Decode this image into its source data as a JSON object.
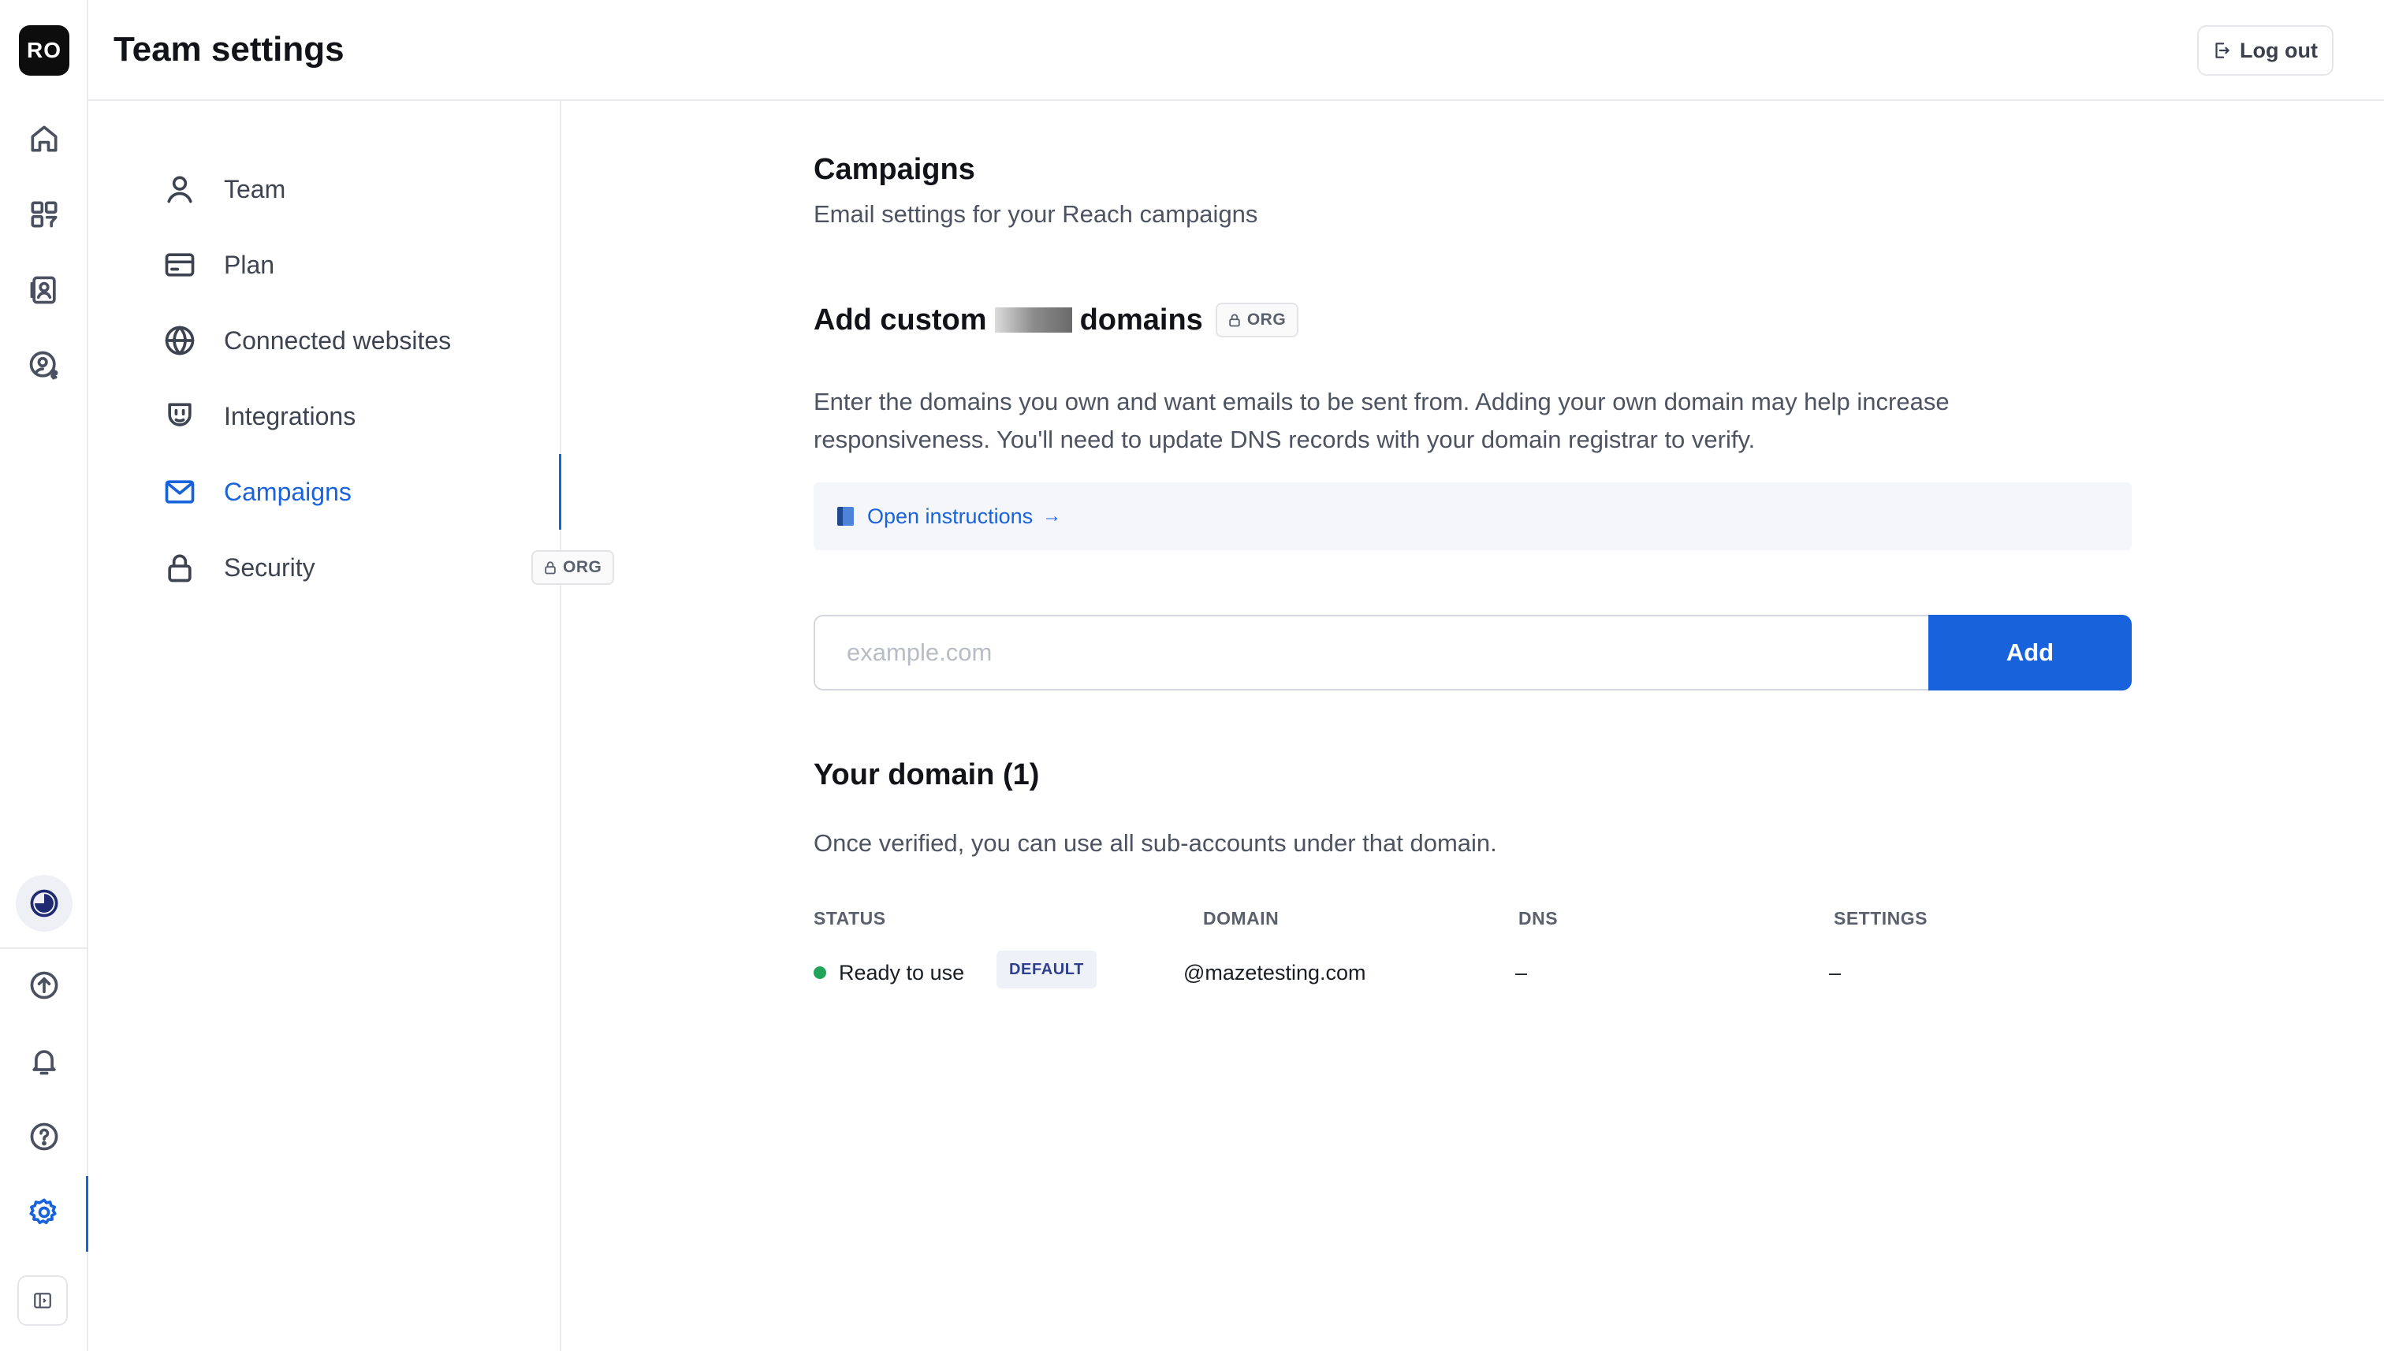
{
  "rail": {
    "avatar": "RO",
    "items": [
      {
        "icon": "home-icon"
      },
      {
        "icon": "apps-icon"
      },
      {
        "icon": "contacts-icon"
      },
      {
        "icon": "user-money-icon"
      },
      {
        "icon": "timer-icon"
      },
      {
        "icon": "upgrade-icon"
      },
      {
        "icon": "bell-icon"
      },
      {
        "icon": "help-icon"
      },
      {
        "icon": "gear-icon"
      }
    ]
  },
  "header": {
    "title": "Team settings",
    "logout_label": "Log out"
  },
  "subnav": {
    "items": [
      {
        "label": "Team",
        "icon": "user-icon"
      },
      {
        "label": "Plan",
        "icon": "credit-card-icon"
      },
      {
        "label": "Connected websites",
        "icon": "globe-icon"
      },
      {
        "label": "Integrations",
        "icon": "plug-icon"
      },
      {
        "label": "Campaigns",
        "icon": "mail-icon",
        "active": true
      },
      {
        "label": "Security",
        "icon": "lock-icon",
        "badge": "ORG"
      }
    ]
  },
  "main": {
    "title": "Campaigns",
    "subtitle": "Email settings for your Reach campaigns",
    "custom_domains": {
      "title_part1": "Add custom",
      "title_part2": "domains",
      "badge": "ORG",
      "description": "Enter the domains you own and want emails to be sent from. Adding your own domain may help increase responsiveness. You'll need to update DNS records with your domain registrar to verify.",
      "instructions_link": "Open instructions",
      "instructions_arrow": "→",
      "input_placeholder": "example.com",
      "add_label": "Add"
    },
    "your_domains": {
      "title": "Your domain (1)",
      "subtitle": "Once verified, you can use all sub-accounts under that domain.",
      "columns": [
        "STATUS",
        "DOMAIN",
        "DNS",
        "SETTINGS"
      ],
      "rows": [
        {
          "status": "Ready to use",
          "badge": "DEFAULT",
          "domain": "@mazetesting.com",
          "dns": "–",
          "settings": "–"
        }
      ]
    }
  },
  "colors": {
    "accent": "#1863dc",
    "status_ok": "#22a35a"
  }
}
